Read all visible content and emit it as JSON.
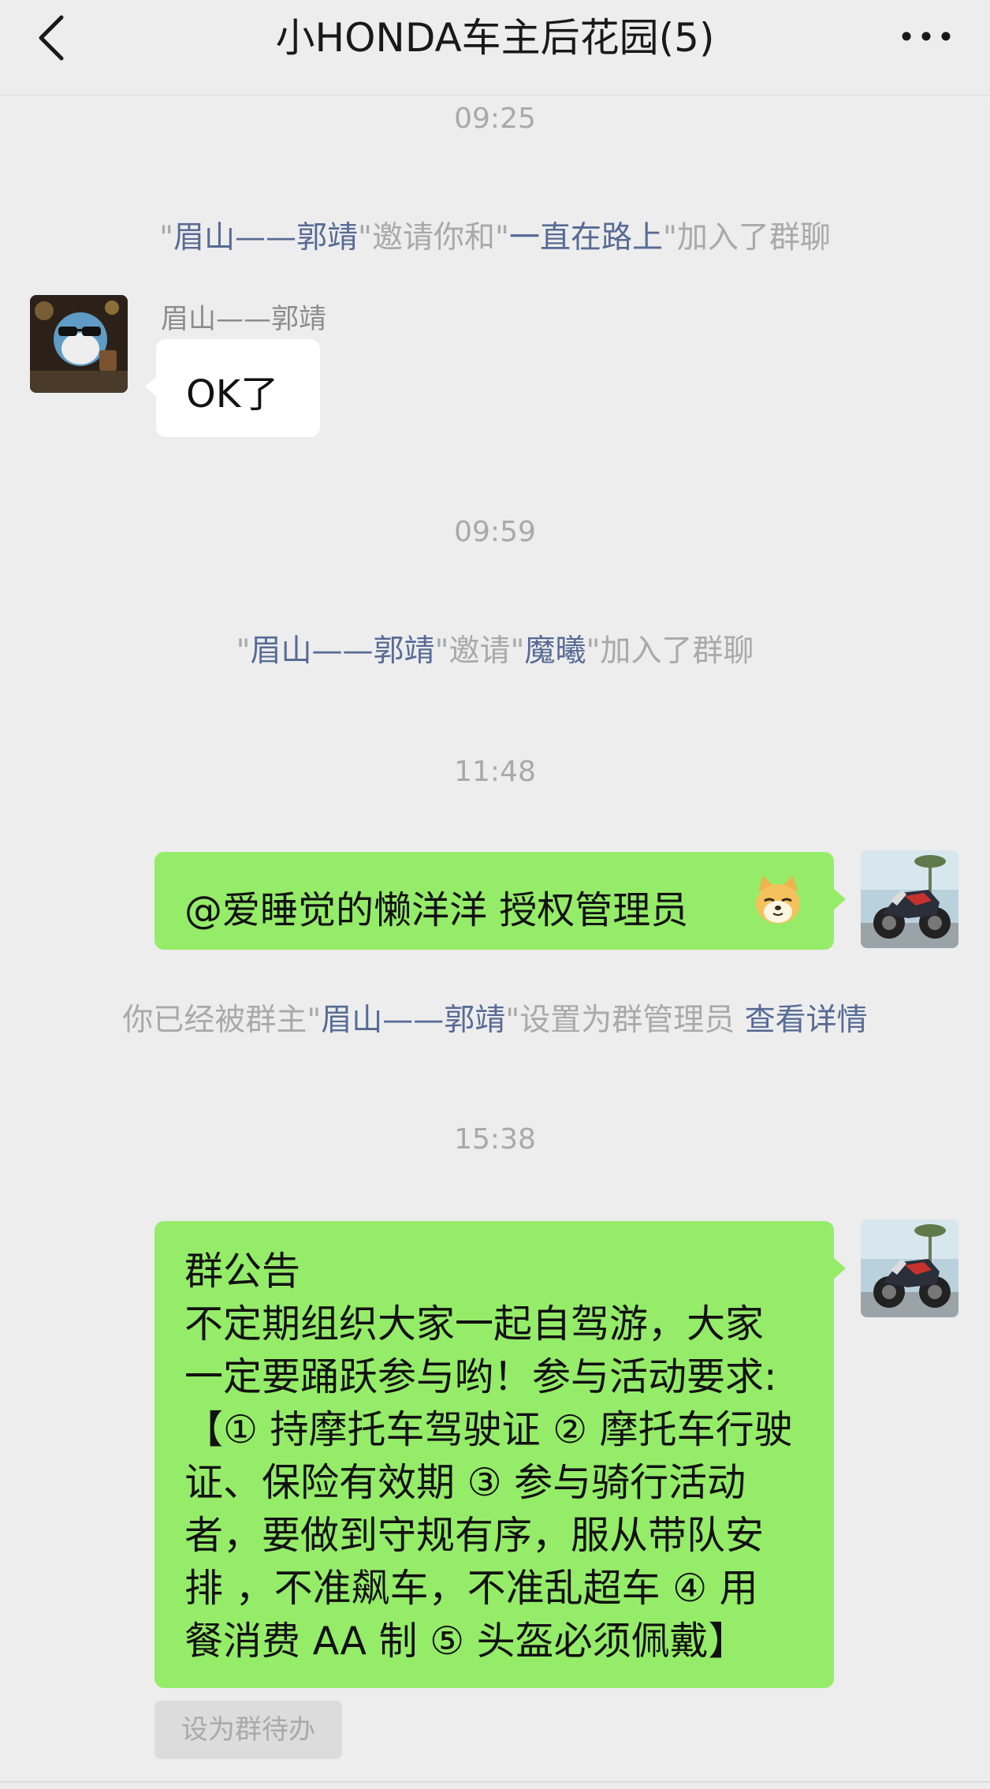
{
  "header": {
    "title": "小HONDA车主后花园(5)",
    "back_icon": "chevron-left-icon",
    "more_icon": "more-dots-icon"
  },
  "messages": {
    "time_1": "09:25",
    "sys_1": {
      "q1": "\"",
      "name1": "眉山——郭靖",
      "mid": "\"邀请你和\"",
      "name2": "一直在路上",
      "end": "\"加入了群聊"
    },
    "sender_name": "眉山——郭靖",
    "received_text": "OK了",
    "time_2": "09:59",
    "sys_2": {
      "q1": "\"",
      "name1": "眉山——郭靖",
      "mid": "\"邀请\"",
      "name2": "魔曦",
      "end": "\"加入了群聊"
    },
    "time_3": "11:48",
    "sent_text": "@爱睡觉的懒洋洋  授权管理员",
    "sent_emoji": "doge-emoji",
    "sys_3": {
      "pre": "你已经被群主\"",
      "name1": "眉山——郭靖",
      "mid": "\"设置为群管理员 ",
      "link": "查看详情"
    },
    "time_4": "15:38",
    "announcement": [
      "群公告",
      "不定期组织大家一起自驾游，大家",
      "一定要踊跃参与哟！参与活动要求:",
      "【① 持摩托车驾驶证 ② 摩托车行驶",
      "证、保险有效期 ③ 参与骑行活动",
      "者，要做到守规有序，服从带队安",
      "排 ，不准飙车，不准乱超车 ④ 用",
      "餐消费 AA 制 ⑤ 头盔必须佩戴】"
    ],
    "todo_label": "设为群待办"
  },
  "colors": {
    "background": "#ededed",
    "green_bubble": "#95ec69",
    "link": "#576b95",
    "gray_text": "#a9a9a9"
  }
}
